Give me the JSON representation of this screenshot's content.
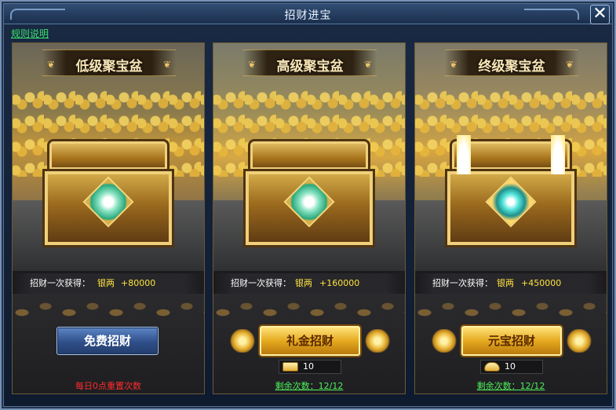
{
  "window": {
    "title": "招财进宝",
    "close_label": "✕",
    "rules_link": "规则说明"
  },
  "panels": [
    {
      "title": "低级聚宝盆",
      "reward_label": "招财一次获得：",
      "reward_currency": "银两",
      "reward_amount": "+80000",
      "button_label": "免费招财",
      "footer_text": "每日0点重置次数"
    },
    {
      "title": "高级聚宝盆",
      "reward_label": "招财一次获得：",
      "reward_currency": "银两",
      "reward_amount": "+160000",
      "button_label": "礼金招财",
      "cost_icon": "gold-ingot-icon",
      "cost_value": "10",
      "remaining_text": "剩余次数：12/12"
    },
    {
      "title": "终级聚宝盆",
      "reward_label": "招财一次获得：",
      "reward_currency": "银两",
      "reward_amount": "+450000",
      "button_label": "元宝招财",
      "cost_icon": "yuanbao-ingot-icon",
      "cost_value": "10",
      "remaining_text": "剩余次数：12/12"
    }
  ],
  "colors": {
    "reward_yellow": "#ffe340",
    "reset_red": "#ff2b2b",
    "remaining_green": "#4ef05b",
    "rules_green": "#39e06d"
  }
}
